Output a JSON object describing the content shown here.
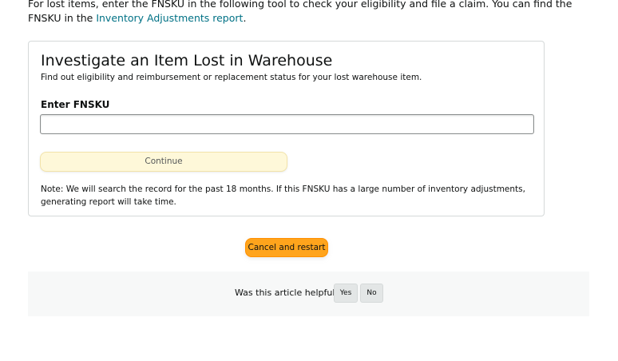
{
  "intro": {
    "text_before": "For lost items, enter the FNSKU in the following tool to check your eligibility and file a claim. You can find the FNSKU in the ",
    "link_label": "Inventory Adjustments report",
    "text_after": "."
  },
  "tool": {
    "title": "Investigate an Item Lost in Warehouse",
    "subtitle": "Find out eligibility and reimbursement or replacement status for your lost warehouse item.",
    "field_label": "Enter FNSKU",
    "field_value": "",
    "field_placeholder": "",
    "continue_label": "Continue",
    "note": "Note: We will search the record for the past 18 months. If this FNSKU has a large number of inventory adjustments, generating report will take time."
  },
  "actions": {
    "cancel_label": "Cancel and restart"
  },
  "feedback": {
    "question": "Was this article helpful?",
    "yes_label": "Yes",
    "no_label": "No"
  },
  "colors": {
    "link": "#007185",
    "continue_bg": "#fef8d9",
    "cancel_bg": "#ffa41c",
    "feedback_bg": "#f7f8f8"
  }
}
